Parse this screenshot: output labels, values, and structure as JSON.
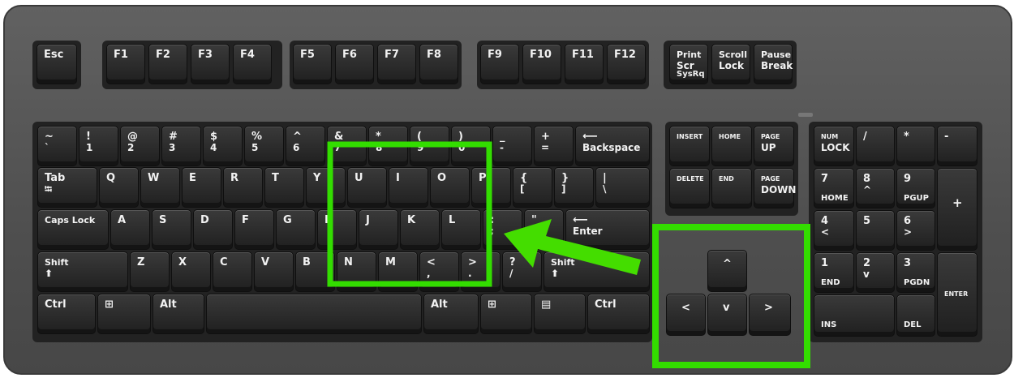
{
  "keys": {
    "esc": "Esc",
    "f1": "F1",
    "f2": "F2",
    "f3": "F3",
    "f4": "F4",
    "f5": "F5",
    "f6": "F6",
    "f7": "F7",
    "f8": "F8",
    "f9": "F9",
    "f10": "F10",
    "f11": "F11",
    "f12": "F12",
    "print_1": "Print",
    "print_2": "Scr",
    "print_3": "SysRq",
    "scroll_1": "Scroll",
    "scroll_2": "Lock",
    "pause_1": "Pause",
    "pause_2": "Break",
    "tilde_top": "~",
    "tilde_bot": "`",
    "n1_top": "!",
    "n1_bot": "1",
    "n2_top": "@",
    "n2_bot": "2",
    "n3_top": "#",
    "n3_bot": "3",
    "n4_top": "$",
    "n4_bot": "4",
    "n5_top": "%",
    "n5_bot": "5",
    "n6_top": "^",
    "n6_bot": "6",
    "n7_top": "&",
    "n7_bot": "7",
    "n8_top": "*",
    "n8_bot": "8",
    "n9_top": "(",
    "n9_bot": "9",
    "n0_top": ")",
    "n0_bot": "0",
    "minus_top": "_",
    "minus_bot": "-",
    "equals_top": "+",
    "equals_bot": "=",
    "backspace_arrow": "⟵",
    "backspace": "Backspace",
    "tab": "Tab",
    "tab_icon": "⭾",
    "q": "Q",
    "w": "W",
    "e": "E",
    "r": "R",
    "t": "T",
    "y": "Y",
    "u": "U",
    "i": "I",
    "o": "O",
    "p": "P",
    "lbrace_top": "{",
    "lbrace_bot": "[",
    "rbrace_top": "}",
    "rbrace_bot": "]",
    "pipe_top": "|",
    "pipe_bot": "\\",
    "caps": "Caps Lock",
    "a": "A",
    "s": "S",
    "d": "D",
    "f": "F",
    "g": "G",
    "h": "H",
    "j": "J",
    "k": "K",
    "l": "L",
    "semi_top": ":",
    "semi_bot": ";",
    "quote_top": "\"",
    "quote_bot": "'",
    "enter_arrow": "⟵",
    "enter": "Enter",
    "shift": "Shift",
    "shift_icon": "⬆",
    "z": "Z",
    "x": "X",
    "c": "C",
    "v": "V",
    "b": "B",
    "n": "N",
    "m": "M",
    "comma_top": "<",
    "comma_bot": ",",
    "period_top": ">",
    "period_bot": ".",
    "slash_top": "?",
    "slash_bot": "/",
    "ctrl": "Ctrl",
    "alt": "Alt",
    "win_icon": "⊞",
    "menu_icon": "▤",
    "insert": "INSERT",
    "home": "HOME",
    "pageup_1": "PAGE",
    "pageup_2": "UP",
    "delete": "DELETE",
    "end": "END",
    "pagedown_1": "PAGE",
    "pagedown_2": "DOWN",
    "up": "^",
    "left": "<",
    "down": "v",
    "right": ">",
    "numlock_1": "NUM",
    "numlock_2": "LOCK",
    "np_div": "/",
    "np_mul": "*",
    "np_minus": "-",
    "np_plus": "+",
    "np7": "7",
    "np7_sub": "HOME",
    "np8": "8",
    "np8_sub": "^",
    "np9": "9",
    "np9_sub": "PGUP",
    "np4": "4",
    "np4_sub": "<",
    "np5": "5",
    "np6": "6",
    "np6_sub": ">",
    "np1": "1",
    "np1_sub": "END",
    "np2": "2",
    "np2_sub": "v",
    "np3": "3",
    "np3_sub": "PGDN",
    "np0_sub": "INS",
    "npdot_sub": "DEL",
    "np_enter": "ENTER"
  },
  "highlight": {
    "color": "#33dd00",
    "arrow_color": "#44dd00"
  }
}
